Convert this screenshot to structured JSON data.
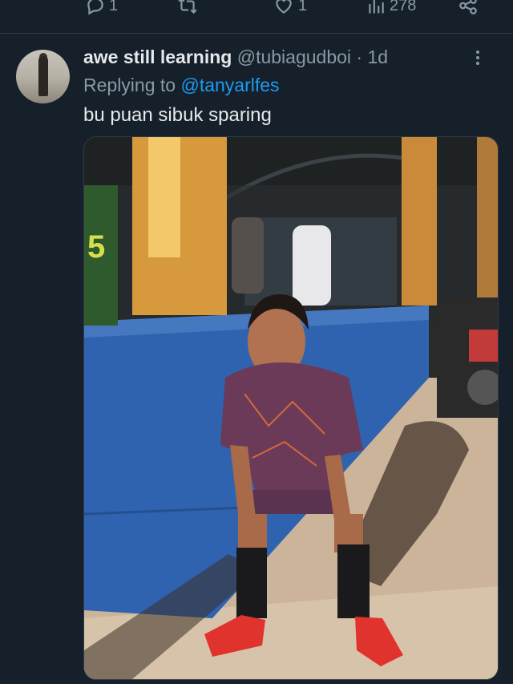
{
  "prev_tweet_actions": {
    "reply_count": "1",
    "retweet_count": "",
    "like_count": "1",
    "view_count": "278"
  },
  "tweet": {
    "display_name": "awe still learning",
    "handle": "@tubiagudboi",
    "separator": "·",
    "time": "1d",
    "replying_prefix": "Replying to ",
    "replying_to": "@tanyarlfes",
    "text": "bu puan sibuk sparing"
  },
  "photo": {
    "jersey_number": "5"
  },
  "icons": {
    "reply": "reply-icon",
    "retweet": "retweet-icon",
    "like": "heart-icon",
    "views": "views-icon",
    "share": "share-icon",
    "more": "more-icon"
  },
  "colors": {
    "background": "#15202b",
    "link": "#1d9bf0",
    "muted": "#8b98a5"
  }
}
